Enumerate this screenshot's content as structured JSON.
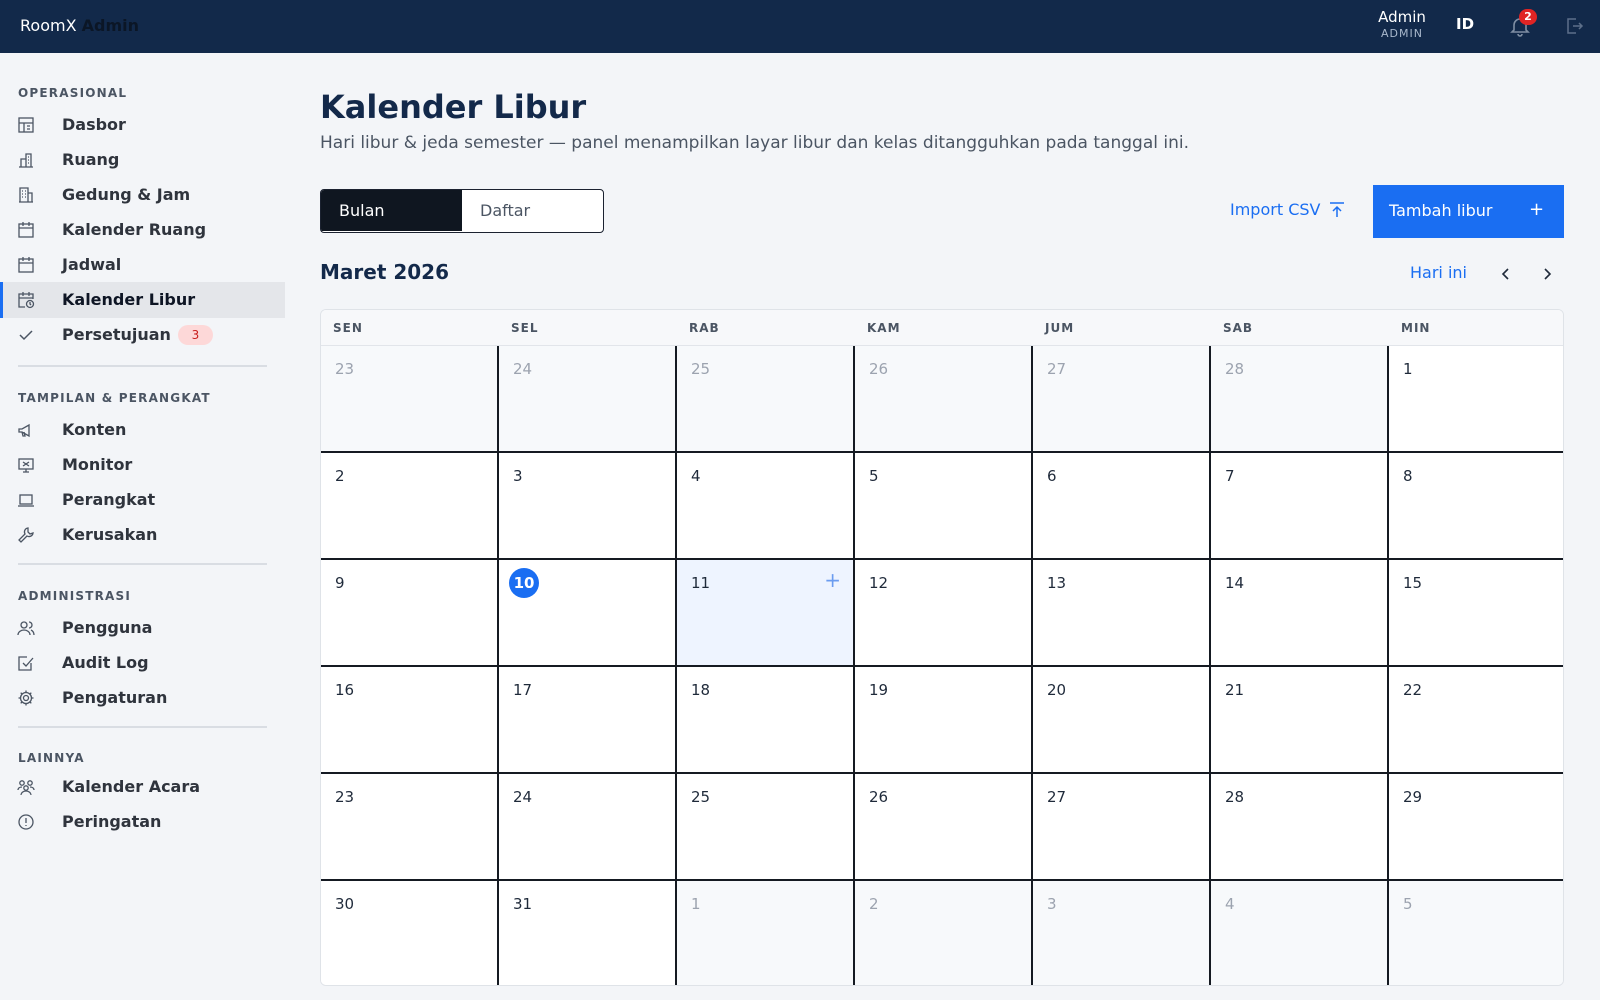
{
  "app": {
    "brand_a": "RoomX",
    "brand_b": "Admin"
  },
  "header": {
    "user_name": "Admin",
    "user_role": "ADMIN",
    "language": "ID",
    "notif_count": "2"
  },
  "sidebar": {
    "sections": [
      {
        "title": "OPERASIONAL",
        "items": [
          {
            "label": "Dasbor",
            "icon": "dashboard-icon"
          },
          {
            "label": "Ruang",
            "icon": "room-icon"
          },
          {
            "label": "Gedung & Jam",
            "icon": "building-icon"
          },
          {
            "label": "Kalender Ruang",
            "icon": "calendar-icon"
          },
          {
            "label": "Jadwal",
            "icon": "schedule-icon"
          },
          {
            "label": "Kalender Libur",
            "icon": "holiday-calendar-icon",
            "active": true
          },
          {
            "label": "Persetujuan",
            "icon": "check-icon",
            "badge": "3"
          }
        ]
      },
      {
        "title": "TAMPILAN & PERANGKAT",
        "items": [
          {
            "label": "Konten",
            "icon": "megaphone-icon"
          },
          {
            "label": "Monitor",
            "icon": "monitor-icon"
          },
          {
            "label": "Perangkat",
            "icon": "laptop-icon"
          },
          {
            "label": "Kerusakan",
            "icon": "wrench-icon"
          }
        ]
      },
      {
        "title": "ADMINISTRASI",
        "items": [
          {
            "label": "Pengguna",
            "icon": "users-icon"
          },
          {
            "label": "Audit Log",
            "icon": "audit-icon"
          },
          {
            "label": "Pengaturan",
            "icon": "gear-icon"
          }
        ]
      },
      {
        "title": "LAINNYA",
        "items": [
          {
            "label": "Kalender Acara",
            "icon": "event-group-icon"
          },
          {
            "label": "Peringatan",
            "icon": "alert-icon"
          }
        ]
      }
    ]
  },
  "main": {
    "title": "Kalender Libur",
    "subtitle": "Hari libur & jeda semester — panel menampilkan layar libur dan kelas ditangguhkan pada tanggal ini.",
    "view_tabs": [
      "Bulan",
      "Daftar"
    ],
    "active_view": "Bulan",
    "import_label": "Import CSV",
    "add_label": "Tambah libur",
    "add_plus": "+",
    "month_label": "Maret 2026",
    "today_label": "Hari ini"
  },
  "calendar": {
    "weekdays": [
      "SEN",
      "SEL",
      "RAB",
      "KAM",
      "JUM",
      "SAB",
      "MIN"
    ],
    "today": 10,
    "hovered": 11,
    "hover_plus": "+",
    "weeks": [
      [
        {
          "d": "23",
          "out": true
        },
        {
          "d": "24",
          "out": true
        },
        {
          "d": "25",
          "out": true
        },
        {
          "d": "26",
          "out": true
        },
        {
          "d": "27",
          "out": true
        },
        {
          "d": "28",
          "out": true
        },
        {
          "d": "1"
        }
      ],
      [
        {
          "d": "2"
        },
        {
          "d": "3"
        },
        {
          "d": "4"
        },
        {
          "d": "5"
        },
        {
          "d": "6"
        },
        {
          "d": "7"
        },
        {
          "d": "8"
        }
      ],
      [
        {
          "d": "9"
        },
        {
          "d": "10"
        },
        {
          "d": "11"
        },
        {
          "d": "12"
        },
        {
          "d": "13"
        },
        {
          "d": "14"
        },
        {
          "d": "15"
        }
      ],
      [
        {
          "d": "16"
        },
        {
          "d": "17"
        },
        {
          "d": "18"
        },
        {
          "d": "19"
        },
        {
          "d": "20"
        },
        {
          "d": "21"
        },
        {
          "d": "22"
        }
      ],
      [
        {
          "d": "23"
        },
        {
          "d": "24"
        },
        {
          "d": "25"
        },
        {
          "d": "26"
        },
        {
          "d": "27"
        },
        {
          "d": "28"
        },
        {
          "d": "29"
        }
      ],
      [
        {
          "d": "30"
        },
        {
          "d": "31"
        },
        {
          "d": "1",
          "out": true
        },
        {
          "d": "2",
          "out": true
        },
        {
          "d": "3",
          "out": true
        },
        {
          "d": "4",
          "out": true
        },
        {
          "d": "5",
          "out": true
        }
      ]
    ]
  },
  "colors": {
    "accent": "#1a6ef2",
    "topbar": "#12294a",
    "alert": "#e02424"
  }
}
